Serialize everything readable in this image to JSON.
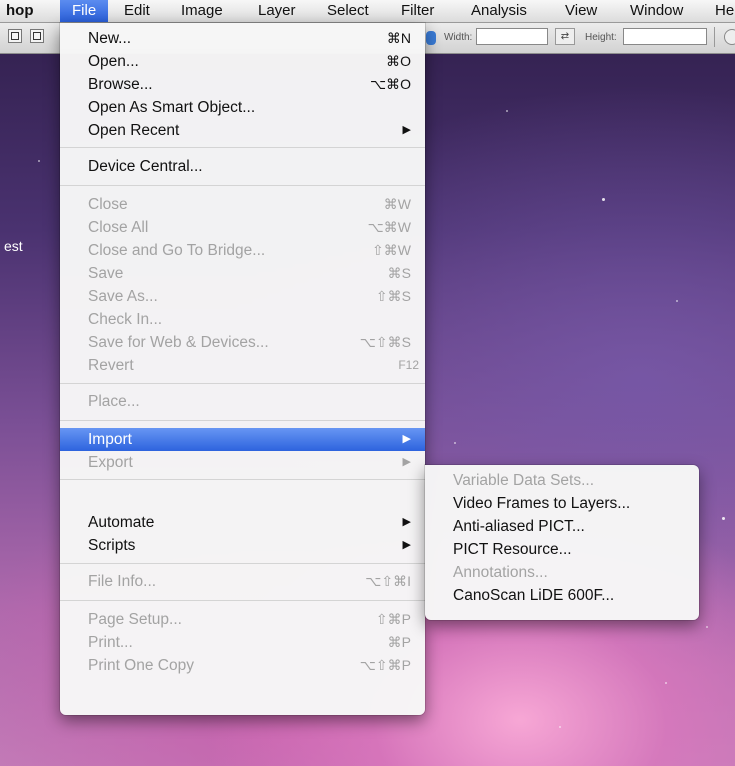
{
  "menubar": {
    "app": "hop",
    "file": "File",
    "edit": "Edit",
    "image": "Image",
    "layer": "Layer",
    "select": "Select",
    "filter": "Filter",
    "analysis": "Analysis",
    "view": "View",
    "window": "Window",
    "help": "He"
  },
  "toolbar": {
    "width_label": "Width:",
    "height_label": "Height:"
  },
  "side_text": "est",
  "file_menu": {
    "new": {
      "label": "New...",
      "shortcut": "⌘N"
    },
    "open": {
      "label": "Open...",
      "shortcut": "⌘O"
    },
    "browse": {
      "label": "Browse...",
      "shortcut": "⌥⌘O"
    },
    "open_smart": {
      "label": "Open As Smart Object..."
    },
    "open_recent": {
      "label": "Open Recent",
      "arrow": "▶"
    },
    "device_central": {
      "label": "Device Central..."
    },
    "close": {
      "label": "Close",
      "shortcut": "⌘W"
    },
    "close_all": {
      "label": "Close All",
      "shortcut": "⌥⌘W"
    },
    "close_bridge": {
      "label": "Close and Go To Bridge...",
      "shortcut": "⇧⌘W"
    },
    "save": {
      "label": "Save",
      "shortcut": "⌘S"
    },
    "save_as": {
      "label": "Save As...",
      "shortcut": "⇧⌘S"
    },
    "check_in": {
      "label": "Check In..."
    },
    "save_web": {
      "label": "Save for Web & Devices...",
      "shortcut": "⌥⇧⌘S"
    },
    "revert": {
      "label": "Revert",
      "shortcut": "F12"
    },
    "place": {
      "label": "Place..."
    },
    "import": {
      "label": "Import",
      "arrow": "▶"
    },
    "export": {
      "label": "Export",
      "arrow": "▶"
    },
    "automate": {
      "label": "Automate",
      "arrow": "▶"
    },
    "scripts": {
      "label": "Scripts",
      "arrow": "▶"
    },
    "file_info": {
      "label": "File Info...",
      "shortcut": "⌥⇧⌘I"
    },
    "page_setup": {
      "label": "Page Setup...",
      "shortcut": "⇧⌘P"
    },
    "print": {
      "label": "Print...",
      "shortcut": "⌘P"
    },
    "print_one": {
      "label": "Print One Copy",
      "shortcut": "⌥⇧⌘P"
    }
  },
  "import_menu": {
    "variable_data": "Variable Data Sets...",
    "video_frames": "Video Frames to Layers...",
    "anti_aliased": "Anti-aliased PICT...",
    "pict_resource": "PICT Resource...",
    "annotations": "Annotations...",
    "canoscan": "CanoScan LiDE 600F..."
  }
}
